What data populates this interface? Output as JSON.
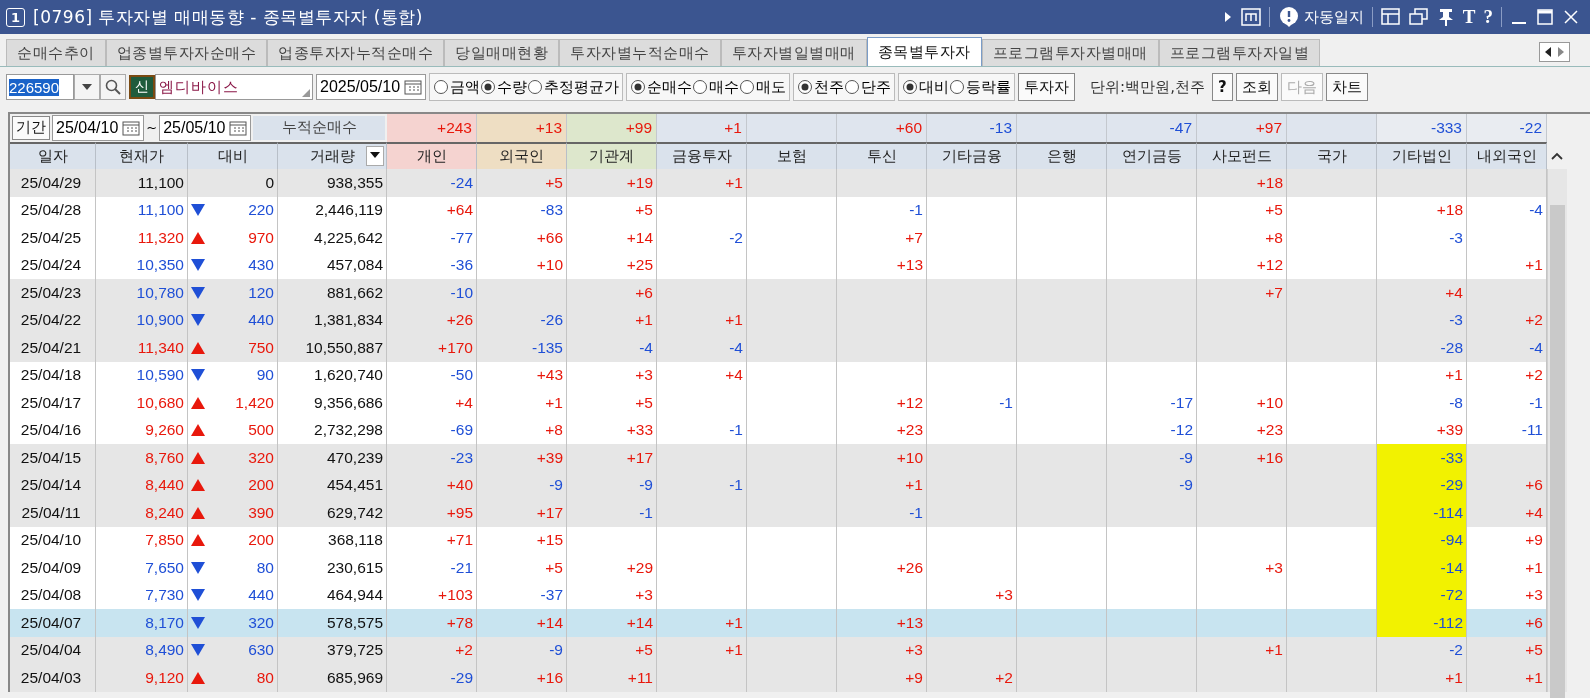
{
  "window": {
    "number": "1",
    "title": "[0796] 투자자별 매매동향 - 종목별투자자 (통합)",
    "tool_label": "자동일지",
    "glyph_tools": [
      "T",
      "?"
    ]
  },
  "tabs": [
    {
      "label": "순매수추이",
      "selected": false
    },
    {
      "label": "업종별투자자순매수",
      "selected": false
    },
    {
      "label": "업종투자자누적순매수",
      "selected": false
    },
    {
      "label": "당일매매현황",
      "selected": false
    },
    {
      "label": "투자자별누적순매수",
      "selected": false
    },
    {
      "label": "투자자별일별매매",
      "selected": false
    },
    {
      "label": "종목별투자자",
      "selected": true
    },
    {
      "label": "프로그램투자자별매매",
      "selected": false
    },
    {
      "label": "프로그램투자자일별",
      "selected": false
    }
  ],
  "toolbar": {
    "code": "226590",
    "badge": "신",
    "stock_name": "엠디바이스",
    "date": "2025/05/10",
    "radio_groups": [
      [
        {
          "label": "금액",
          "selected": false
        },
        {
          "label": "수량",
          "selected": true
        },
        {
          "label": "추정평균가",
          "selected": false
        }
      ],
      [
        {
          "label": "순매수",
          "selected": true
        },
        {
          "label": "매수",
          "selected": false
        },
        {
          "label": "매도",
          "selected": false
        }
      ],
      [
        {
          "label": "천주",
          "selected": true
        },
        {
          "label": "단주",
          "selected": false
        }
      ],
      [
        {
          "label": "대비",
          "selected": true
        },
        {
          "label": "등락률",
          "selected": false
        }
      ]
    ],
    "investor_button": "투자자",
    "unit": "단위:백만원,천주",
    "buttons": [
      {
        "label": "?",
        "disabled": false
      },
      {
        "label": "조회",
        "disabled": false
      },
      {
        "label": "다음",
        "disabled": true
      },
      {
        "label": "차트",
        "disabled": false
      }
    ]
  },
  "period": {
    "label": "기간",
    "from": "25/04/10",
    "separator": "~",
    "to": "25/05/10",
    "summary_label": "누적순매수"
  },
  "fixed_columns": [
    "일자",
    "현재가",
    "대비",
    "거래량"
  ],
  "investor_columns": [
    {
      "label": "개인",
      "color": "#f5d3d0"
    },
    {
      "label": "외국인",
      "color": "#eedec3"
    },
    {
      "label": "기관계",
      "color": "#dde7cc"
    },
    {
      "label": "금융투자"
    },
    {
      "label": "보험"
    },
    {
      "label": "투신"
    },
    {
      "label": "기타금융"
    },
    {
      "label": "은행"
    },
    {
      "label": "연기금등"
    },
    {
      "label": "사모펀드"
    },
    {
      "label": "국가"
    },
    {
      "label": "기타법인"
    },
    {
      "label": "내외국인"
    }
  ],
  "totals": [
    {
      "kind": "num",
      "text": "+243"
    },
    {
      "kind": "num",
      "text": "+13"
    },
    {
      "kind": "num",
      "text": "+99"
    },
    {
      "kind": "num",
      "text": "+1"
    },
    {
      "kind": "blank"
    },
    {
      "kind": "num",
      "text": "+60"
    },
    {
      "kind": "num",
      "text": "-13"
    },
    {
      "kind": "blank"
    },
    {
      "kind": "num",
      "text": "-47"
    },
    {
      "kind": "num",
      "text": "+97"
    },
    {
      "kind": "blank"
    },
    {
      "kind": "num",
      "text": "-333"
    },
    {
      "kind": "num",
      "text": "-22"
    }
  ],
  "rows": [
    {
      "date": "25/04/29",
      "price": "11,100",
      "rising": false,
      "falling": false,
      "change": "0",
      "volume": "938,355",
      "shaded": true,
      "selected": false,
      "highlighted": false,
      "values": [
        {
          "kind": "num",
          "text": "-24"
        },
        {
          "kind": "num",
          "text": "+5"
        },
        {
          "kind": "num",
          "text": "+19"
        },
        {
          "kind": "num",
          "text": "+1"
        },
        {
          "kind": "blank"
        },
        {
          "kind": "blank"
        },
        {
          "kind": "blank"
        },
        {
          "kind": "blank"
        },
        {
          "kind": "blank"
        },
        {
          "kind": "num",
          "text": "+18"
        },
        {
          "kind": "blank"
        },
        {
          "kind": "blank"
        },
        {
          "kind": "blank"
        }
      ]
    },
    {
      "date": "25/04/28",
      "price": "11,100",
      "rising": false,
      "falling": true,
      "change": "220",
      "volume": "2,446,119",
      "shaded": false,
      "selected": false,
      "highlighted": false,
      "values": [
        {
          "kind": "num",
          "text": "+64"
        },
        {
          "kind": "num",
          "text": "-83"
        },
        {
          "kind": "num",
          "text": "+5"
        },
        {
          "kind": "blank"
        },
        {
          "kind": "blank"
        },
        {
          "kind": "num",
          "text": "-1"
        },
        {
          "kind": "blank"
        },
        {
          "kind": "blank"
        },
        {
          "kind": "blank"
        },
        {
          "kind": "num",
          "text": "+5"
        },
        {
          "kind": "blank"
        },
        {
          "kind": "num",
          "text": "+18"
        },
        {
          "kind": "num",
          "text": "-4"
        }
      ]
    },
    {
      "date": "25/04/25",
      "price": "11,320",
      "rising": true,
      "falling": false,
      "change": "970",
      "volume": "4,225,642",
      "shaded": false,
      "selected": false,
      "highlighted": false,
      "values": [
        {
          "kind": "num",
          "text": "-77"
        },
        {
          "kind": "num",
          "text": "+66"
        },
        {
          "kind": "num",
          "text": "+14"
        },
        {
          "kind": "num",
          "text": "-2"
        },
        {
          "kind": "blank"
        },
        {
          "kind": "num",
          "text": "+7"
        },
        {
          "kind": "blank"
        },
        {
          "kind": "blank"
        },
        {
          "kind": "blank"
        },
        {
          "kind": "num",
          "text": "+8"
        },
        {
          "kind": "blank"
        },
        {
          "kind": "num",
          "text": "-3"
        },
        {
          "kind": "blank"
        }
      ]
    },
    {
      "date": "25/04/24",
      "price": "10,350",
      "rising": false,
      "falling": true,
      "change": "430",
      "volume": "457,084",
      "shaded": false,
      "selected": false,
      "highlighted": false,
      "values": [
        {
          "kind": "num",
          "text": "-36"
        },
        {
          "kind": "num",
          "text": "+10"
        },
        {
          "kind": "num",
          "text": "+25"
        },
        {
          "kind": "blank"
        },
        {
          "kind": "blank"
        },
        {
          "kind": "num",
          "text": "+13"
        },
        {
          "kind": "blank"
        },
        {
          "kind": "blank"
        },
        {
          "kind": "blank"
        },
        {
          "kind": "num",
          "text": "+12"
        },
        {
          "kind": "blank"
        },
        {
          "kind": "blank"
        },
        {
          "kind": "num",
          "text": "+1"
        }
      ]
    },
    {
      "date": "25/04/23",
      "price": "10,780",
      "rising": false,
      "falling": true,
      "change": "120",
      "volume": "881,662",
      "shaded": true,
      "selected": false,
      "highlighted": false,
      "values": [
        {
          "kind": "num",
          "text": "-10"
        },
        {
          "kind": "blank"
        },
        {
          "kind": "num",
          "text": "+6"
        },
        {
          "kind": "blank"
        },
        {
          "kind": "blank"
        },
        {
          "kind": "blank"
        },
        {
          "kind": "blank"
        },
        {
          "kind": "blank"
        },
        {
          "kind": "blank"
        },
        {
          "kind": "num",
          "text": "+7"
        },
        {
          "kind": "blank"
        },
        {
          "kind": "num",
          "text": "+4"
        },
        {
          "kind": "blank"
        }
      ]
    },
    {
      "date": "25/04/22",
      "price": "10,900",
      "rising": false,
      "falling": true,
      "change": "440",
      "volume": "1,381,834",
      "shaded": true,
      "selected": false,
      "highlighted": false,
      "values": [
        {
          "kind": "num",
          "text": "+26"
        },
        {
          "kind": "num",
          "text": "-26"
        },
        {
          "kind": "num",
          "text": "+1"
        },
        {
          "kind": "num",
          "text": "+1"
        },
        {
          "kind": "blank"
        },
        {
          "kind": "blank"
        },
        {
          "kind": "blank"
        },
        {
          "kind": "blank"
        },
        {
          "kind": "blank"
        },
        {
          "kind": "blank"
        },
        {
          "kind": "blank"
        },
        {
          "kind": "num",
          "text": "-3"
        },
        {
          "kind": "num",
          "text": "+2"
        }
      ]
    },
    {
      "date": "25/04/21",
      "price": "11,340",
      "rising": true,
      "falling": false,
      "change": "750",
      "volume": "10,550,887",
      "shaded": true,
      "selected": false,
      "highlighted": false,
      "values": [
        {
          "kind": "num",
          "text": "+170"
        },
        {
          "kind": "num",
          "text": "-135"
        },
        {
          "kind": "num",
          "text": "-4"
        },
        {
          "kind": "num",
          "text": "-4"
        },
        {
          "kind": "blank"
        },
        {
          "kind": "blank"
        },
        {
          "kind": "blank"
        },
        {
          "kind": "blank"
        },
        {
          "kind": "blank"
        },
        {
          "kind": "blank"
        },
        {
          "kind": "blank"
        },
        {
          "kind": "num",
          "text": "-28"
        },
        {
          "kind": "num",
          "text": "-4"
        }
      ]
    },
    {
      "date": "25/04/18",
      "price": "10,590",
      "rising": false,
      "falling": true,
      "change": "90",
      "volume": "1,620,740",
      "shaded": false,
      "selected": false,
      "highlighted": false,
      "values": [
        {
          "kind": "num",
          "text": "-50"
        },
        {
          "kind": "num",
          "text": "+43"
        },
        {
          "kind": "num",
          "text": "+3"
        },
        {
          "kind": "num",
          "text": "+4"
        },
        {
          "kind": "blank"
        },
        {
          "kind": "blank"
        },
        {
          "kind": "blank"
        },
        {
          "kind": "blank"
        },
        {
          "kind": "blank"
        },
        {
          "kind": "blank"
        },
        {
          "kind": "blank"
        },
        {
          "kind": "num",
          "text": "+1"
        },
        {
          "kind": "num",
          "text": "+2"
        }
      ]
    },
    {
      "date": "25/04/17",
      "price": "10,680",
      "rising": true,
      "falling": false,
      "change": "1,420",
      "volume": "9,356,686",
      "shaded": false,
      "selected": false,
      "highlighted": false,
      "values": [
        {
          "kind": "num",
          "text": "+4"
        },
        {
          "kind": "num",
          "text": "+1"
        },
        {
          "kind": "num",
          "text": "+5"
        },
        {
          "kind": "blank"
        },
        {
          "kind": "blank"
        },
        {
          "kind": "num",
          "text": "+12"
        },
        {
          "kind": "num",
          "text": "-1"
        },
        {
          "kind": "blank"
        },
        {
          "kind": "num",
          "text": "-17"
        },
        {
          "kind": "num",
          "text": "+10"
        },
        {
          "kind": "blank"
        },
        {
          "kind": "num",
          "text": "-8"
        },
        {
          "kind": "num",
          "text": "-1"
        }
      ]
    },
    {
      "date": "25/04/16",
      "price": "9,260",
      "rising": true,
      "falling": false,
      "change": "500",
      "volume": "2,732,298",
      "shaded": false,
      "selected": false,
      "highlighted": false,
      "values": [
        {
          "kind": "num",
          "text": "-69"
        },
        {
          "kind": "num",
          "text": "+8"
        },
        {
          "kind": "num",
          "text": "+33"
        },
        {
          "kind": "num",
          "text": "-1"
        },
        {
          "kind": "blank"
        },
        {
          "kind": "num",
          "text": "+23"
        },
        {
          "kind": "blank"
        },
        {
          "kind": "blank"
        },
        {
          "kind": "num",
          "text": "-12"
        },
        {
          "kind": "num",
          "text": "+23"
        },
        {
          "kind": "blank"
        },
        {
          "kind": "num",
          "text": "+39"
        },
        {
          "kind": "num",
          "text": "-11"
        }
      ]
    },
    {
      "date": "25/04/15",
      "price": "8,760",
      "rising": true,
      "falling": false,
      "change": "320",
      "volume": "470,239",
      "shaded": true,
      "selected": false,
      "highlighted": true,
      "values": [
        {
          "kind": "num",
          "text": "-23"
        },
        {
          "kind": "num",
          "text": "+39"
        },
        {
          "kind": "num",
          "text": "+17"
        },
        {
          "kind": "blank"
        },
        {
          "kind": "blank"
        },
        {
          "kind": "num",
          "text": "+10"
        },
        {
          "kind": "blank"
        },
        {
          "kind": "blank"
        },
        {
          "kind": "num",
          "text": "-9"
        },
        {
          "kind": "num",
          "text": "+16"
        },
        {
          "kind": "blank"
        },
        {
          "kind": "num",
          "text": "-33"
        },
        {
          "kind": "blank"
        }
      ]
    },
    {
      "date": "25/04/14",
      "price": "8,440",
      "rising": true,
      "falling": false,
      "change": "200",
      "volume": "454,451",
      "shaded": true,
      "selected": false,
      "highlighted": true,
      "values": [
        {
          "kind": "num",
          "text": "+40"
        },
        {
          "kind": "num",
          "text": "-9"
        },
        {
          "kind": "num",
          "text": "-9"
        },
        {
          "kind": "num",
          "text": "-1"
        },
        {
          "kind": "blank"
        },
        {
          "kind": "num",
          "text": "+1"
        },
        {
          "kind": "blank"
        },
        {
          "kind": "blank"
        },
        {
          "kind": "num",
          "text": "-9"
        },
        {
          "kind": "blank"
        },
        {
          "kind": "blank"
        },
        {
          "kind": "num",
          "text": "-29"
        },
        {
          "kind": "num",
          "text": "+6"
        }
      ]
    },
    {
      "date": "25/04/11",
      "price": "8,240",
      "rising": true,
      "falling": false,
      "change": "390",
      "volume": "629,742",
      "shaded": true,
      "selected": false,
      "highlighted": true,
      "values": [
        {
          "kind": "num",
          "text": "+95"
        },
        {
          "kind": "num",
          "text": "+17"
        },
        {
          "kind": "num",
          "text": "-1"
        },
        {
          "kind": "blank"
        },
        {
          "kind": "blank"
        },
        {
          "kind": "num",
          "text": "-1"
        },
        {
          "kind": "blank"
        },
        {
          "kind": "blank"
        },
        {
          "kind": "blank"
        },
        {
          "kind": "blank"
        },
        {
          "kind": "blank"
        },
        {
          "kind": "num",
          "text": "-114"
        },
        {
          "kind": "num",
          "text": "+4"
        }
      ]
    },
    {
      "date": "25/04/10",
      "price": "7,850",
      "rising": true,
      "falling": false,
      "change": "200",
      "volume": "368,118",
      "shaded": false,
      "selected": false,
      "highlighted": true,
      "values": [
        {
          "kind": "num",
          "text": "+71"
        },
        {
          "kind": "num",
          "text": "+15"
        },
        {
          "kind": "blank"
        },
        {
          "kind": "blank"
        },
        {
          "kind": "blank"
        },
        {
          "kind": "blank"
        },
        {
          "kind": "blank"
        },
        {
          "kind": "blank"
        },
        {
          "kind": "blank"
        },
        {
          "kind": "blank"
        },
        {
          "kind": "blank"
        },
        {
          "kind": "num",
          "text": "-94"
        },
        {
          "kind": "num",
          "text": "+9"
        }
      ]
    },
    {
      "date": "25/04/09",
      "price": "7,650",
      "rising": false,
      "falling": true,
      "change": "80",
      "volume": "230,615",
      "shaded": false,
      "selected": false,
      "highlighted": true,
      "values": [
        {
          "kind": "num",
          "text": "-21"
        },
        {
          "kind": "num",
          "text": "+5"
        },
        {
          "kind": "num",
          "text": "+29"
        },
        {
          "kind": "blank"
        },
        {
          "kind": "blank"
        },
        {
          "kind": "num",
          "text": "+26"
        },
        {
          "kind": "blank"
        },
        {
          "kind": "blank"
        },
        {
          "kind": "blank"
        },
        {
          "kind": "num",
          "text": "+3"
        },
        {
          "kind": "blank"
        },
        {
          "kind": "num",
          "text": "-14"
        },
        {
          "kind": "num",
          "text": "+1"
        }
      ]
    },
    {
      "date": "25/04/08",
      "price": "7,730",
      "rising": false,
      "falling": true,
      "change": "440",
      "volume": "464,944",
      "shaded": false,
      "selected": false,
      "highlighted": true,
      "values": [
        {
          "kind": "num",
          "text": "+103"
        },
        {
          "kind": "num",
          "text": "-37"
        },
        {
          "kind": "num",
          "text": "+3"
        },
        {
          "kind": "blank"
        },
        {
          "kind": "blank"
        },
        {
          "kind": "blank"
        },
        {
          "kind": "num",
          "text": "+3"
        },
        {
          "kind": "blank"
        },
        {
          "kind": "blank"
        },
        {
          "kind": "blank"
        },
        {
          "kind": "blank"
        },
        {
          "kind": "num",
          "text": "-72"
        },
        {
          "kind": "num",
          "text": "+3"
        }
      ]
    },
    {
      "date": "25/04/07",
      "price": "8,170",
      "rising": false,
      "falling": true,
      "change": "320",
      "volume": "578,575",
      "selected": true,
      "highlighted": true,
      "values": [
        {
          "kind": "num",
          "text": "+78"
        },
        {
          "kind": "num",
          "text": "+14"
        },
        {
          "kind": "num",
          "text": "+14"
        },
        {
          "kind": "num",
          "text": "+1"
        },
        {
          "kind": "blank"
        },
        {
          "kind": "num",
          "text": "+13"
        },
        {
          "kind": "blank"
        },
        {
          "kind": "blank"
        },
        {
          "kind": "blank"
        },
        {
          "kind": "blank"
        },
        {
          "kind": "blank"
        },
        {
          "kind": "num",
          "text": "-112"
        },
        {
          "kind": "num",
          "text": "+6"
        }
      ]
    },
    {
      "date": "25/04/04",
      "price": "8,490",
      "rising": false,
      "falling": true,
      "change": "630",
      "volume": "379,725",
      "shaded": true,
      "selected": false,
      "highlighted": false,
      "values": [
        {
          "kind": "num",
          "text": "+2"
        },
        {
          "kind": "num",
          "text": "-9"
        },
        {
          "kind": "num",
          "text": "+5"
        },
        {
          "kind": "num",
          "text": "+1"
        },
        {
          "kind": "blank"
        },
        {
          "kind": "num",
          "text": "+3"
        },
        {
          "kind": "blank"
        },
        {
          "kind": "blank"
        },
        {
          "kind": "blank"
        },
        {
          "kind": "num",
          "text": "+1"
        },
        {
          "kind": "blank"
        },
        {
          "kind": "num",
          "text": "-2"
        },
        {
          "kind": "num",
          "text": "+5"
        }
      ]
    },
    {
      "date": "25/04/03",
      "price": "9,120",
      "rising": true,
      "falling": false,
      "change": "80",
      "volume": "685,969",
      "shaded": true,
      "selected": false,
      "highlighted": false,
      "values": [
        {
          "kind": "num",
          "text": "-29"
        },
        {
          "kind": "num",
          "text": "+16"
        },
        {
          "kind": "num",
          "text": "+11"
        },
        {
          "kind": "blank"
        },
        {
          "kind": "blank"
        },
        {
          "kind": "num",
          "text": "+9"
        },
        {
          "kind": "num",
          "text": "+2"
        },
        {
          "kind": "blank"
        },
        {
          "kind": "blank"
        },
        {
          "kind": "blank"
        },
        {
          "kind": "blank"
        },
        {
          "kind": "num",
          "text": "+1"
        },
        {
          "kind": "num",
          "text": "+1"
        }
      ]
    }
  ]
}
